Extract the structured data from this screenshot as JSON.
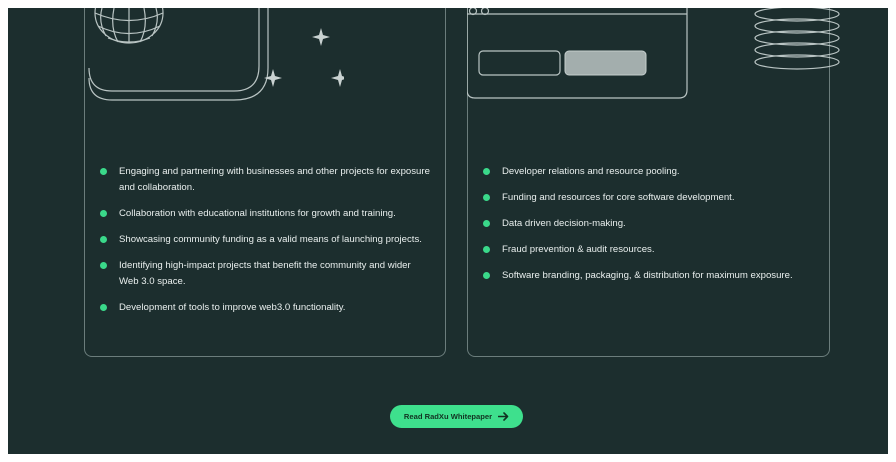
{
  "left_card": {
    "items": [
      "Engaging and partnering with businesses and other projects for exposure and collaboration.",
      "Collaboration with educational institutions for growth and training.",
      "Showcasing community funding as a valid means of launching projects.",
      "Identifying high-impact projects that benefit the community and wider Web 3.0 space.",
      "Development of tools to improve web3.0 functionality."
    ]
  },
  "right_card": {
    "items": [
      "Developer relations and resource pooling.",
      "Funding and resources for core software development.",
      "Data driven decision-making.",
      "Fraud prevention & audit resources.",
      "Software branding, packaging, & distribution for maximum exposure."
    ]
  },
  "cta": {
    "label": "Read RadXu Whitepaper",
    "icon": "arrow-right-icon"
  },
  "colors": {
    "background": "#1c2e2e",
    "accent": "#3ee08d",
    "border": "#6b7d7c",
    "text": "#e9efee"
  },
  "illustrations": {
    "left": "globe-icon",
    "left_sparkles": "sparkle-icon",
    "right": "browser-window-icon",
    "right_coil": "coil-icon"
  }
}
